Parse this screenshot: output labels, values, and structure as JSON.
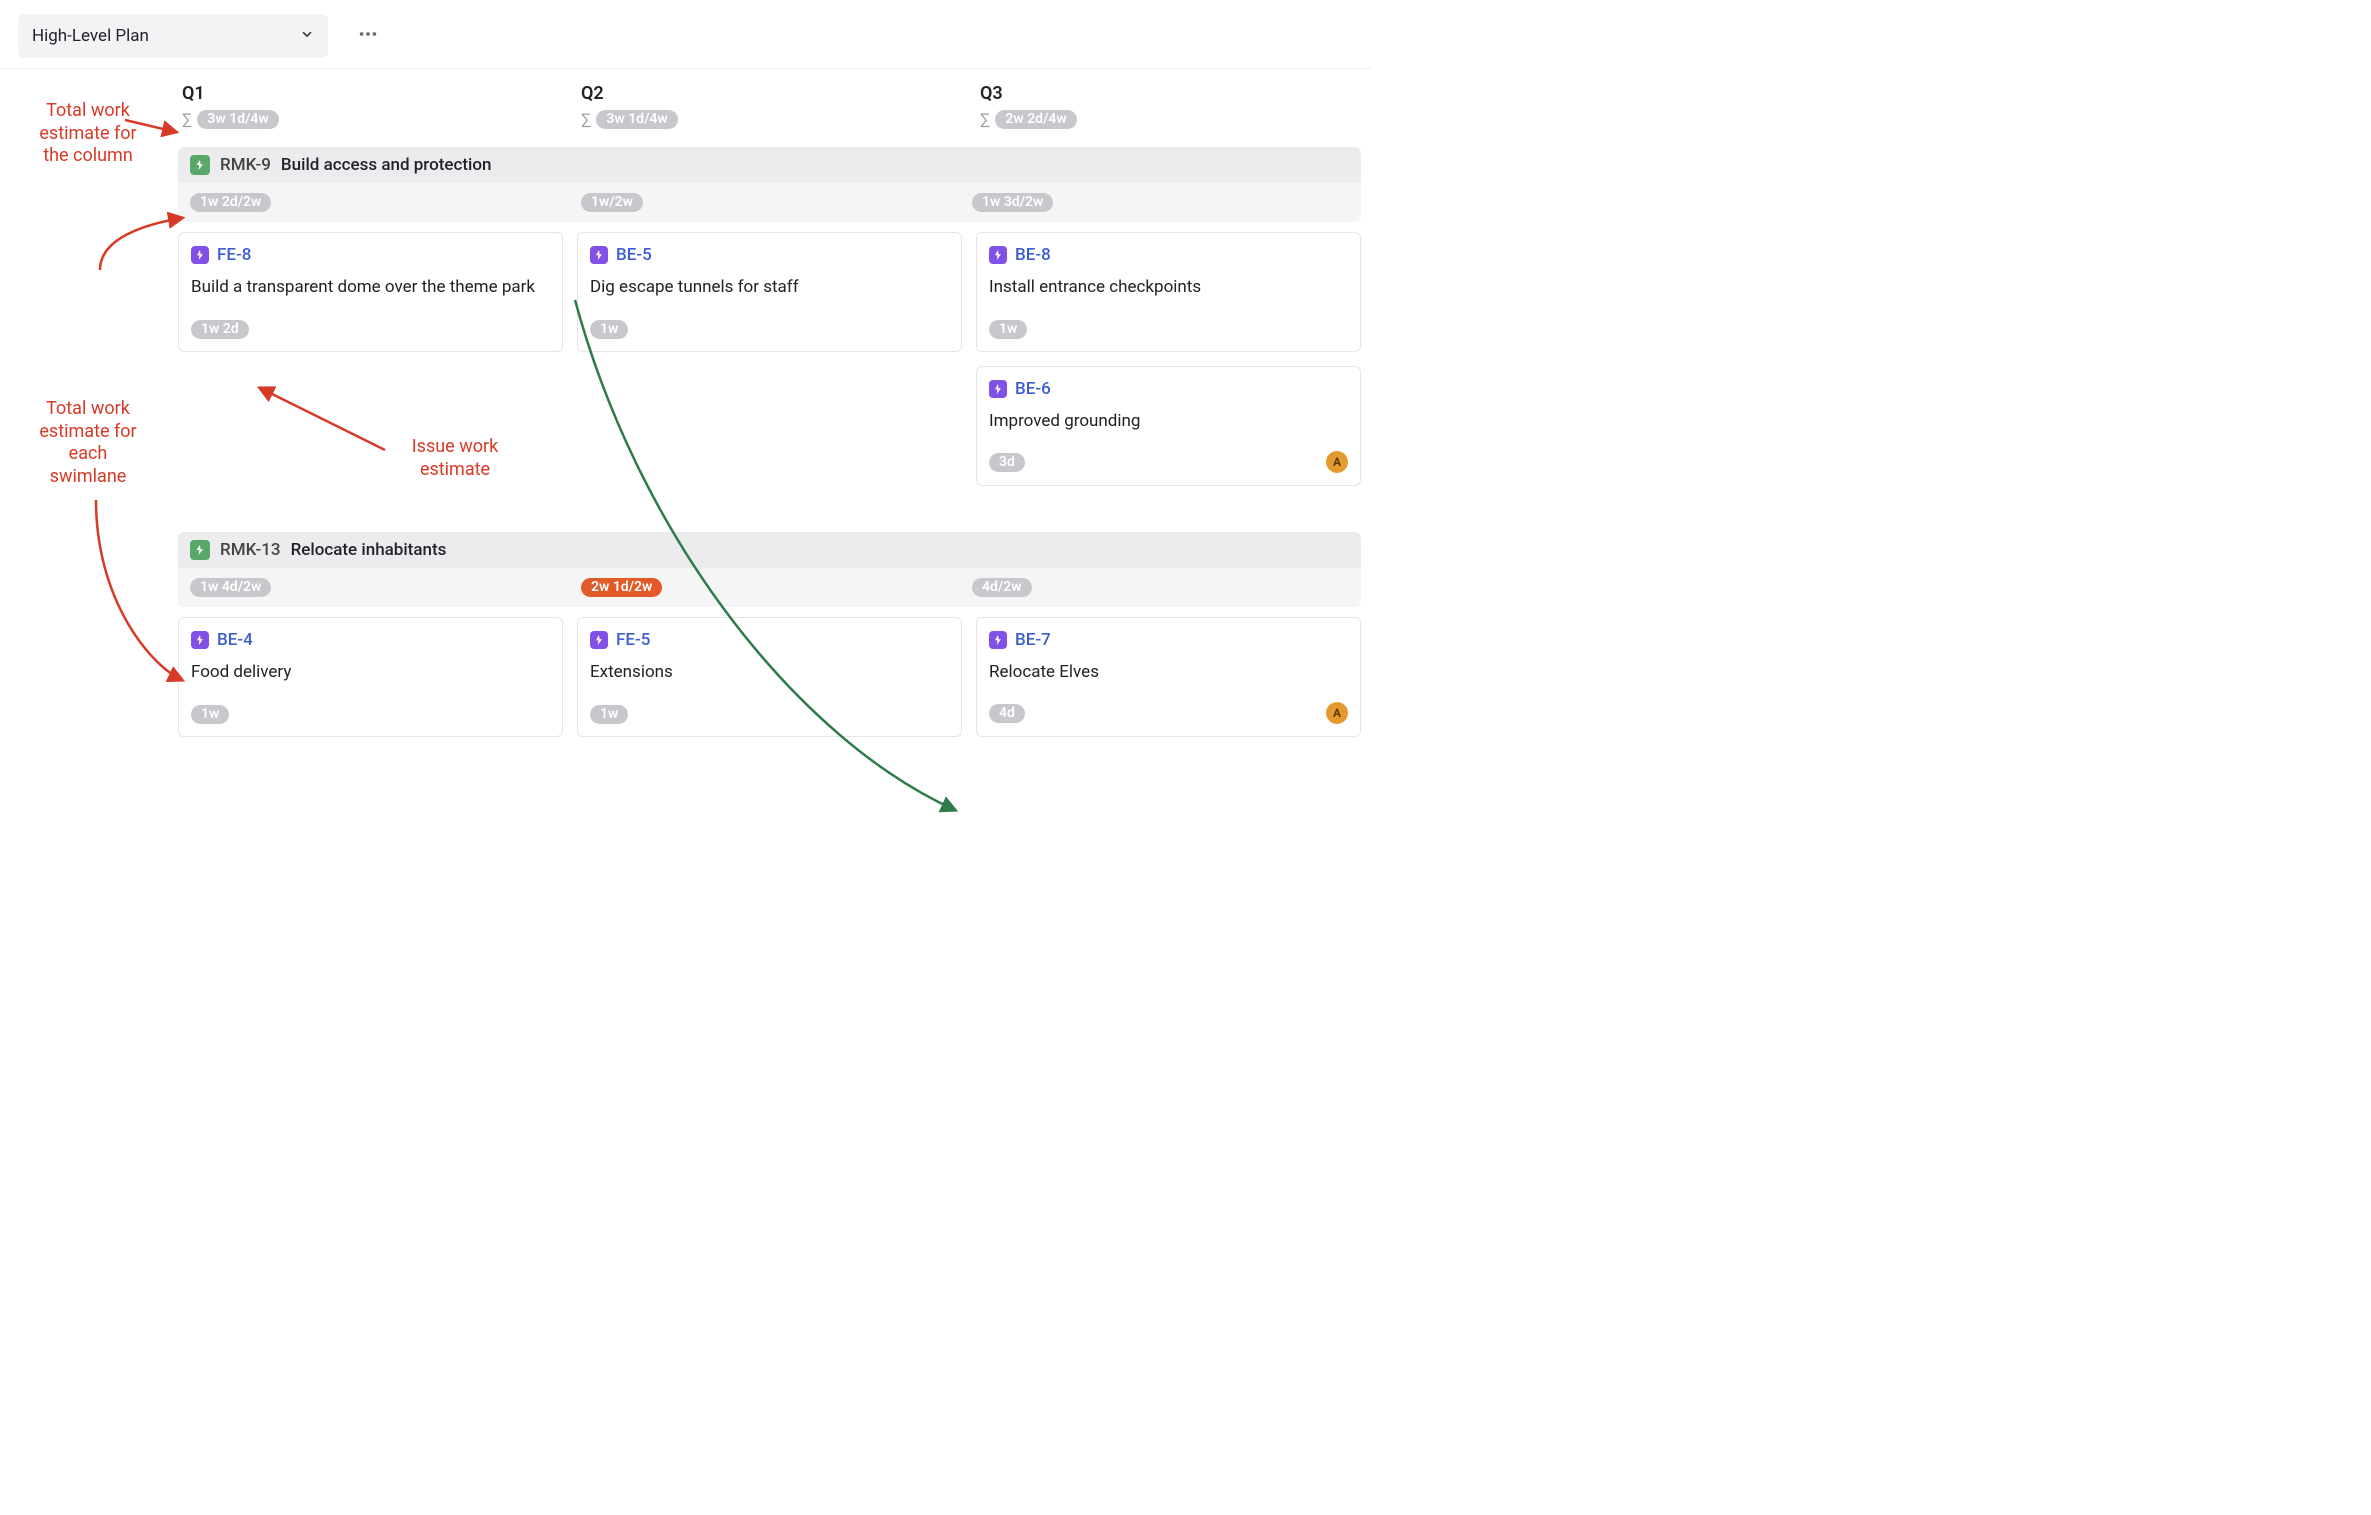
{
  "toolbar": {
    "view_name": "High-Level Plan"
  },
  "columns": [
    {
      "title": "Q1",
      "sum": "3w 1d/4w"
    },
    {
      "title": "Q2",
      "sum": "3w 1d/4w"
    },
    {
      "title": "Q3",
      "sum": "2w 2d/4w"
    }
  ],
  "swimlanes": [
    {
      "key": "RMK-9",
      "title": "Build access and protection",
      "sums": [
        {
          "text": "1w 2d/2w",
          "over": false
        },
        {
          "text": "1w/2w",
          "over": false
        },
        {
          "text": "1w 3d/2w",
          "over": false
        }
      ],
      "cards": [
        [
          {
            "key": "FE-8",
            "title": "Build a transparent dome over the theme park",
            "estimate": "1w 2d"
          }
        ],
        [
          {
            "key": "BE-5",
            "title": "Dig escape tunnels for staff",
            "estimate": "1w"
          }
        ],
        [
          {
            "key": "BE-8",
            "title": "Install entrance checkpoints",
            "estimate": "1w"
          },
          {
            "key": "BE-6",
            "title": "Improved grounding",
            "estimate": "3d",
            "assignee": "A"
          }
        ]
      ]
    },
    {
      "key": "RMK-13",
      "title": "Relocate inhabitants",
      "sums": [
        {
          "text": "1w 4d/2w",
          "over": false
        },
        {
          "text": "2w 1d/2w",
          "over": true
        },
        {
          "text": "4d/2w",
          "over": false
        }
      ],
      "cards": [
        [
          {
            "key": "BE-4",
            "title": "Food delivery",
            "estimate": "1w"
          }
        ],
        [
          {
            "key": "FE-5",
            "title": "Extensions",
            "estimate": "1w"
          }
        ],
        [
          {
            "key": "BE-7",
            "title": "Relocate Elves",
            "estimate": "4d",
            "assignee": "A"
          }
        ]
      ]
    }
  ],
  "annotations": {
    "col_total": "Total work\nestimate for\nthe column",
    "swim_total": "Total work\nestimate for\neach\nswimlane",
    "issue_est": "Issue work\nestimate"
  }
}
